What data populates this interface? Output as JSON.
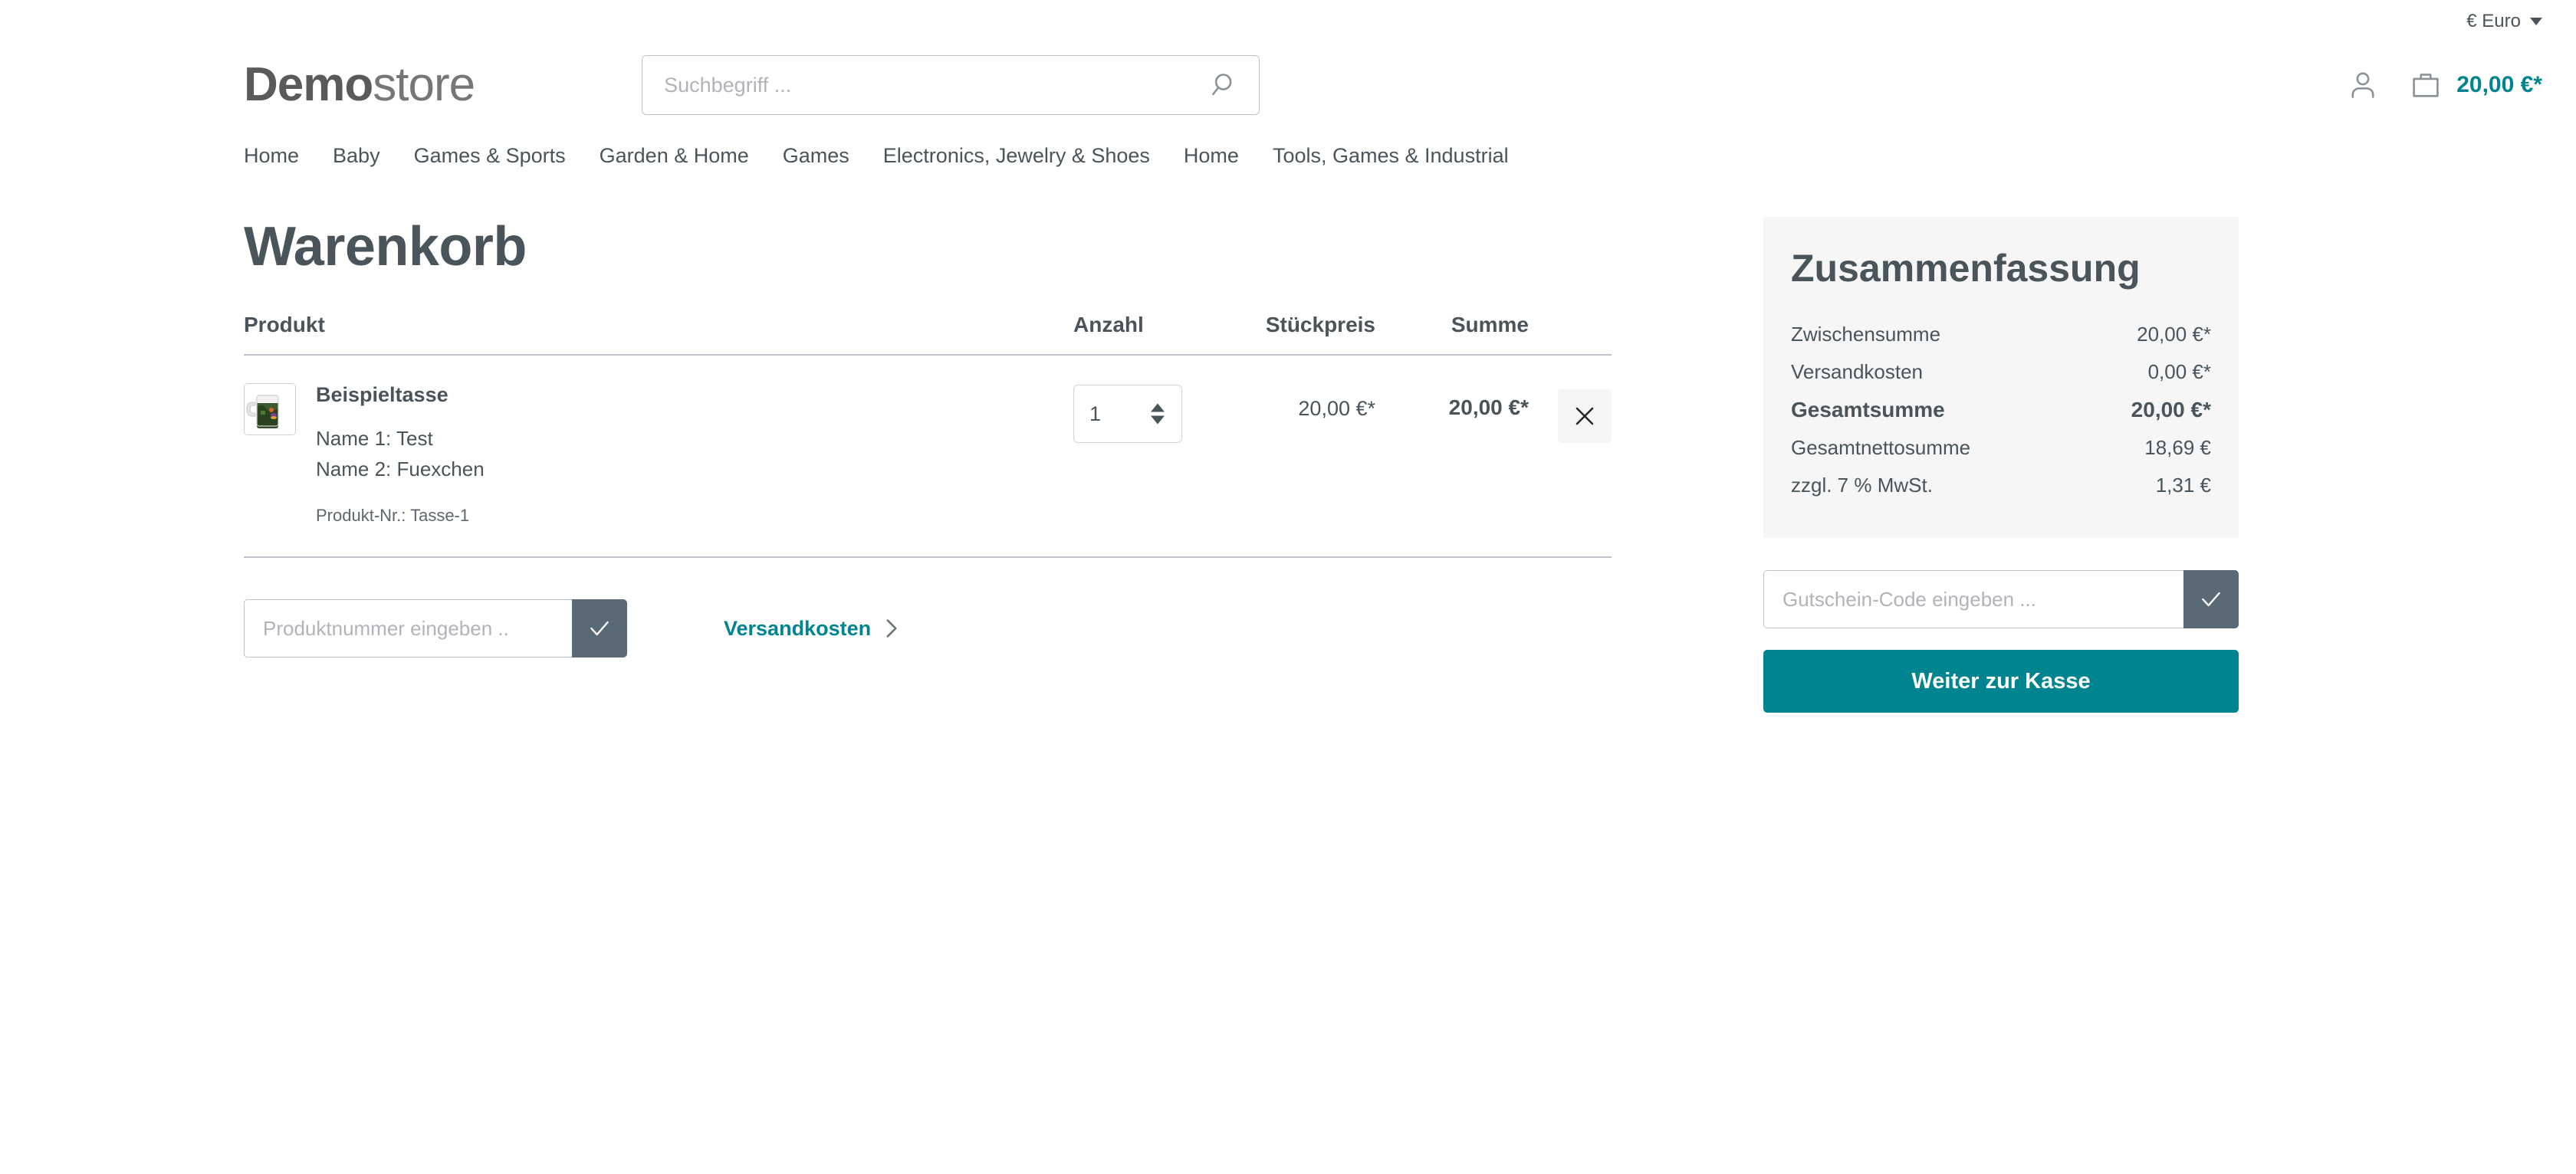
{
  "topbar": {
    "currency_label": "€ Euro",
    "currency_icon": "chevron-down-icon"
  },
  "header": {
    "logo_bold": "Demo",
    "logo_light": "store",
    "search_placeholder": "Suchbegriff ...",
    "search_value": "",
    "search_icon": "search-icon",
    "account_icon": "user-icon",
    "cart_icon": "shopping-bag-icon",
    "cart_total": "20,00 €*"
  },
  "nav": {
    "items": [
      {
        "label": "Home"
      },
      {
        "label": "Baby"
      },
      {
        "label": "Games & Sports"
      },
      {
        "label": "Garden & Home"
      },
      {
        "label": "Games"
      },
      {
        "label": "Electronics, Jewelry & Shoes"
      },
      {
        "label": "Home"
      },
      {
        "label": "Tools, Games & Industrial"
      }
    ]
  },
  "cart": {
    "title": "Warenkorb",
    "columns": {
      "product": "Produkt",
      "quantity": "Anzahl",
      "unit_price": "Stückpreis",
      "total": "Summe"
    },
    "items": [
      {
        "name": "Beispieltasse",
        "option_1": "Name 1: Test",
        "option_2": "Name 2: Fuexchen",
        "product_number": "Produkt-Nr.: Tasse-1",
        "quantity": "1",
        "unit_price": "20,00 €*",
        "line_total": "20,00 €*",
        "remove_icon": "close-icon",
        "thumbnail_alt": "mug-thumbnail"
      }
    ],
    "product_number_placeholder": "Produktnummer eingeben ..",
    "product_number_value": "",
    "product_number_submit_icon": "check-icon",
    "shipping_link_label": "Versandkosten",
    "shipping_link_icon": "chevron-right-icon"
  },
  "summary": {
    "title": "Zusammenfassung",
    "rows": [
      {
        "label": "Zwischensumme",
        "value": "20,00 €*",
        "bold": false
      },
      {
        "label": "Versandkosten",
        "value": "0,00 €*",
        "bold": false
      },
      {
        "label": "Gesamtsumme",
        "value": "20,00 €*",
        "bold": true
      },
      {
        "label": "Gesamtnettosumme",
        "value": "18,69 €",
        "bold": false
      },
      {
        "label": "zzgl. 7 % MwSt.",
        "value": "1,31 €",
        "bold": false
      }
    ],
    "voucher_placeholder": "Gutschein-Code eingeben ...",
    "voucher_value": "",
    "voucher_submit_icon": "check-icon",
    "checkout_label": "Weiter zur Kasse"
  },
  "colors": {
    "accent_teal": "#008490",
    "text_slate": "#4a545b",
    "panel_bg": "#f6f6f6",
    "submit_slate": "#596975",
    "border_gray": "#bcc1c7"
  }
}
